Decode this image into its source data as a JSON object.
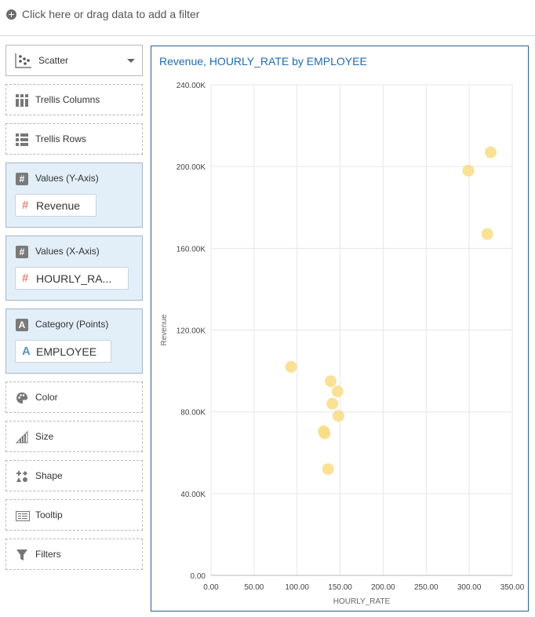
{
  "filter_bar": {
    "label": "Click here or drag data to add a filter"
  },
  "viz_type": {
    "label": "Scatter"
  },
  "wells": {
    "trellis_columns": "Trellis Columns",
    "trellis_rows": "Trellis Rows",
    "values_y": {
      "label": "Values (Y-Axis)",
      "item": "Revenue"
    },
    "values_x": {
      "label": "Values (X-Axis)",
      "item": "HOURLY_RA..."
    },
    "category": {
      "label": "Category (Points)",
      "item": "EMPLOYEE"
    },
    "color": "Color",
    "size": "Size",
    "shape": "Shape",
    "tooltip": "Tooltip",
    "filters": "Filters"
  },
  "colors": {
    "point": "#f8dc84",
    "title": "#1f6bb0",
    "measure_icon": "#e8897a",
    "attribute_icon": "#5b8fc7"
  },
  "chart_data": {
    "type": "scatter",
    "title": "Revenue, HOURLY_RATE by EMPLOYEE",
    "xlabel": "HOURLY_RATE",
    "ylabel": "Revenue",
    "xlim": [
      0,
      350
    ],
    "ylim": [
      0,
      240000
    ],
    "x_ticks": [
      "0.00",
      "50.00",
      "100.00",
      "150.00",
      "200.00",
      "250.00",
      "300.00",
      "350.00"
    ],
    "y_ticks": [
      "0.00",
      "40.00K",
      "80.00K",
      "120.00K",
      "160.00K",
      "200.00K",
      "240.00K"
    ],
    "grid": true,
    "points": [
      {
        "x": 93,
        "y": 102000
      },
      {
        "x": 139,
        "y": 95000
      },
      {
        "x": 147,
        "y": 90000
      },
      {
        "x": 141,
        "y": 84000
      },
      {
        "x": 148,
        "y": 78000
      },
      {
        "x": 131,
        "y": 70500
      },
      {
        "x": 132,
        "y": 69500
      },
      {
        "x": 136,
        "y": 52000
      },
      {
        "x": 299,
        "y": 198000
      },
      {
        "x": 325,
        "y": 207000
      },
      {
        "x": 321,
        "y": 167000
      }
    ]
  }
}
